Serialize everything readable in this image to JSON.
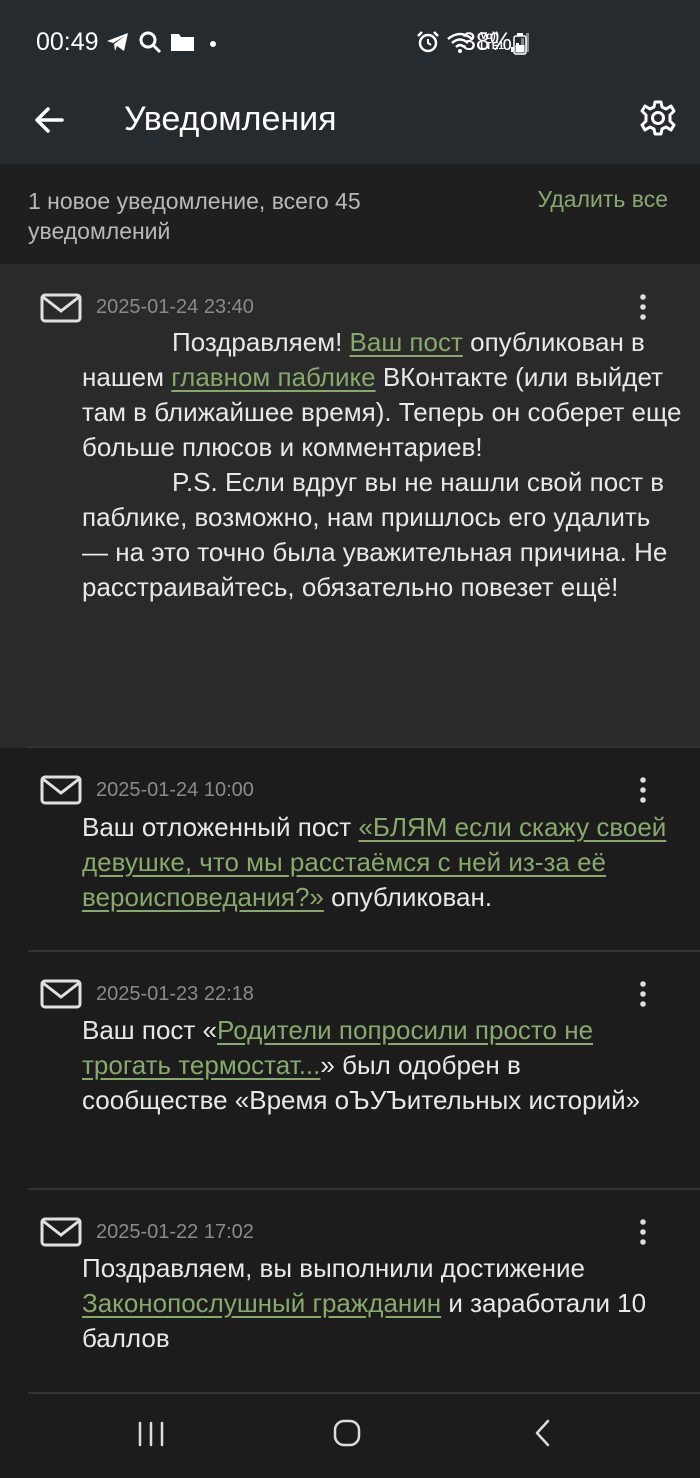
{
  "status_bar": {
    "time": "00:49",
    "battery": "38%",
    "left_icons": [
      "telegram-icon",
      "search-icon",
      "folder-icon",
      "dot-icon"
    ],
    "right_icons": [
      "alarm-icon",
      "wifi-icon",
      "volte-icon",
      "signal-icon"
    ],
    "volte_top": "Vo))",
    "volte_bottom": "LTE1"
  },
  "header": {
    "title": "Уведомления",
    "back_icon": "arrow-left-icon",
    "settings_icon": "gear-icon"
  },
  "summary": {
    "text": "1 новое уведомление, всего 45 уведомлений",
    "delete_all": "Удалить все"
  },
  "notifications": [
    {
      "date": "2025-01-24 23:40",
      "unread": true,
      "p1_a": "Поздравляем! ",
      "p1_link1": "Ваш пост",
      "p1_b": " опубликован в нашем ",
      "p1_link2": "главном паблике",
      "p1_c": " ВКонтакте (или выйдет там в ближайшее время). Теперь он соберет еще больше плюсов и комментариев!",
      "p2": "P.S. Если вдруг вы не нашли свой пост в паблике, возможно, нам пришлось его удалить — на это точно была уважительная причина. Не расстраивайтесь, обязательно повезет ещё!"
    },
    {
      "date": "2025-01-24 10:00",
      "unread": false,
      "a": "Ваш отложенный пост ",
      "link": "«БЛЯМ если скажу своей девушке, что мы расстаёмся с ней из-за её вероисповедания?»",
      "b": " опубликован."
    },
    {
      "date": "2025-01-23 22:18",
      "unread": false,
      "a": "Ваш пост «",
      "link": "Родители попросили просто не трогать термостат...",
      "b": "» был одобрен в сообществе «Время оЪУЪительных историй»"
    },
    {
      "date": "2025-01-22 17:02",
      "unread": false,
      "a": "Поздравляем, вы выполнили достижение ",
      "link": "Законопослушный гражданин",
      "b": " и заработали 10 баллов"
    }
  ],
  "nav_bar": {
    "items": [
      "recent-apps-icon",
      "home-icon",
      "back-icon"
    ]
  },
  "colors": {
    "accent": "#87a96b",
    "background": "#1c1c1c",
    "header": "#252b2f",
    "unread_bg": "#2a2a2a"
  }
}
